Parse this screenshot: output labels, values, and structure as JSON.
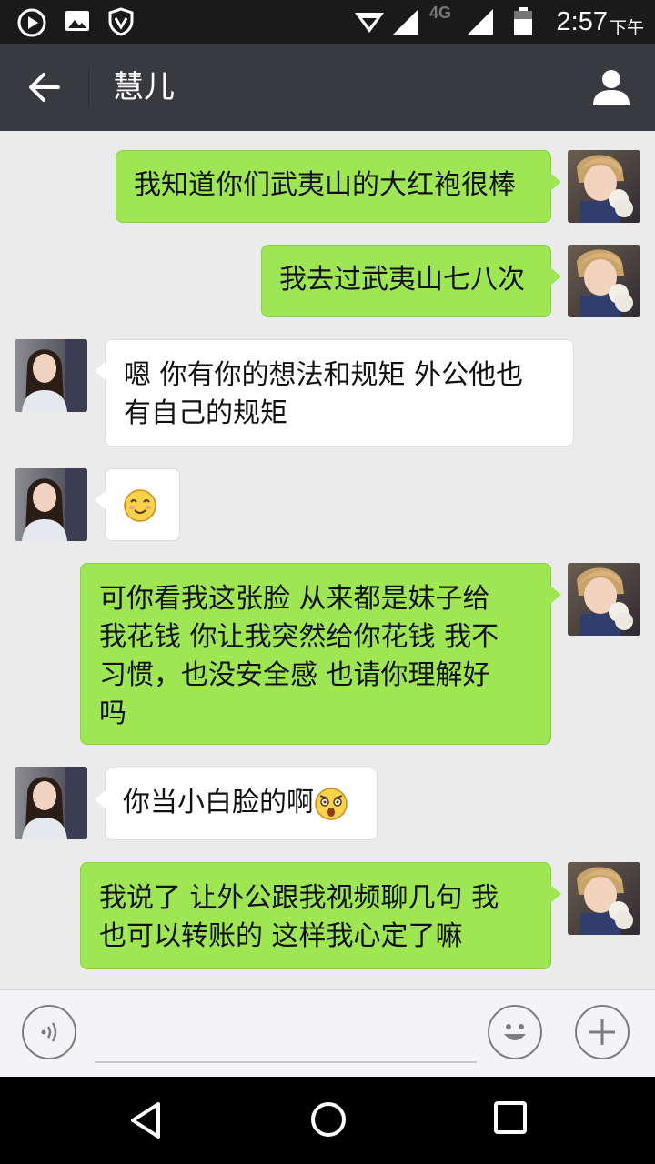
{
  "status_bar": {
    "time": "2:57",
    "ampm": "下午",
    "network": "4G",
    "icons": [
      "play-circle-icon",
      "image-icon",
      "shield-icon",
      "wifi-icon",
      "signal-icon",
      "battery-icon"
    ]
  },
  "header": {
    "title": "慧儿",
    "back_icon": "arrow-left-icon",
    "profile_icon": "person-icon",
    "background": "#393a3f"
  },
  "messages": [
    {
      "direction": "out",
      "text": "我知道你们武夷山的大红袍很棒"
    },
    {
      "direction": "out",
      "text": "我去过武夷山七八次"
    },
    {
      "direction": "in",
      "lines": [
        "嗯 你有你的想法和规矩 外公他也",
        "有自己的规矩"
      ]
    },
    {
      "direction": "in",
      "emoji": "smiling-face-emoji"
    },
    {
      "direction": "out",
      "lines": [
        "可你看我这张脸 从来都是妹子给",
        "我花钱 你让我突然给你花钱 我不",
        "习惯，也没安全感 也请你理解好",
        "吗"
      ]
    },
    {
      "direction": "in",
      "text": "你当小白脸的啊",
      "emoji": "shocked-face-emoji"
    },
    {
      "direction": "out",
      "lines": [
        "我说了 让外公跟我视频聊几句 我",
        "也可以转账的 这样我心定了嘛"
      ]
    }
  ],
  "input_bar": {
    "voice_icon": "voice-icon",
    "emoji_icon": "emoji-icon",
    "plus_icon": "plus-icon",
    "value": ""
  },
  "nav_bar": {
    "icons": [
      "back-triangle-icon",
      "home-circle-icon",
      "recents-square-icon"
    ]
  },
  "colors": {
    "chat_background": "#ebebeb",
    "outgoing_bubble": "#9ee652",
    "incoming_bubble": "#ffffff"
  }
}
